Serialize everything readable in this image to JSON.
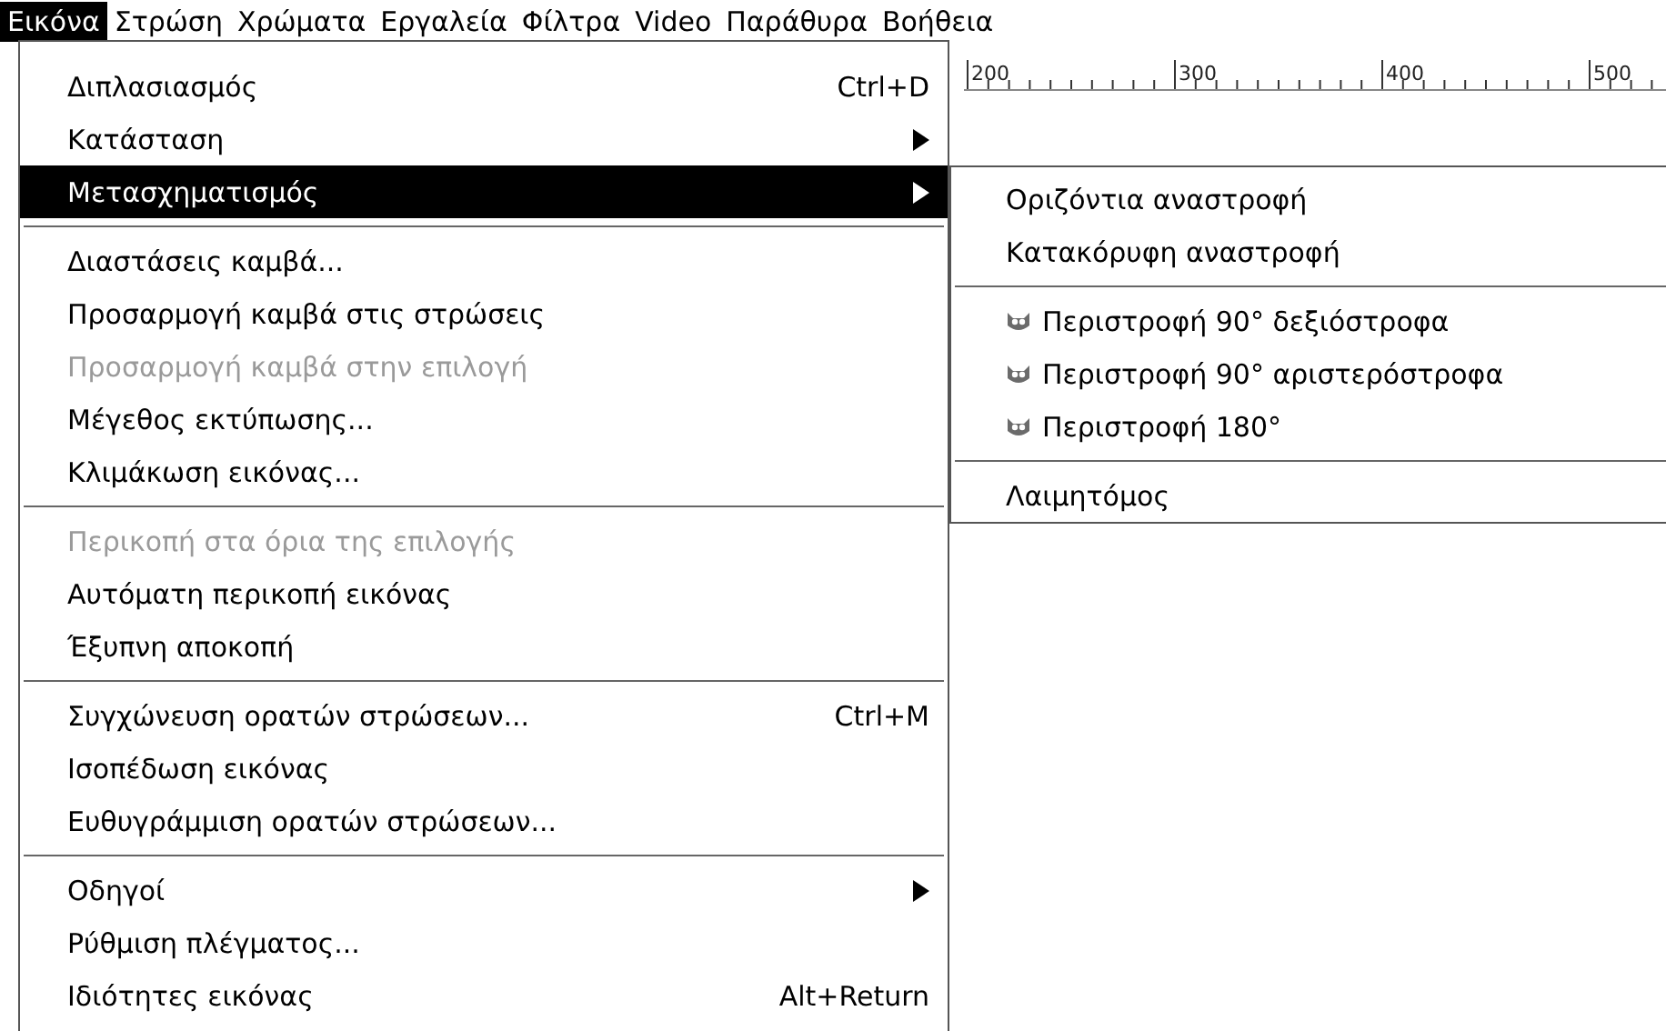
{
  "menubar": [
    {
      "label": "Εικόνα",
      "selected": true
    },
    {
      "label": "Στρώση",
      "selected": false
    },
    {
      "label": "Χρώματα",
      "selected": false
    },
    {
      "label": "Εργαλεία",
      "selected": false
    },
    {
      "label": "Φίλτρα",
      "selected": false
    },
    {
      "label": "Video",
      "selected": false
    },
    {
      "label": "Παράθυρα",
      "selected": false
    },
    {
      "label": "Βοήθεια",
      "selected": false
    }
  ],
  "ruler": {
    "labels": [
      "200",
      "300",
      "400",
      "500"
    ]
  },
  "menu": {
    "items": [
      {
        "kind": "item",
        "label": "Διπλασιασμός",
        "shortcut": "Ctrl+D",
        "submenu": false,
        "disabled": false,
        "selected": false
      },
      {
        "kind": "item",
        "label": "Κατάσταση",
        "submenu": true,
        "disabled": false,
        "selected": false
      },
      {
        "kind": "item",
        "label": "Μετασχηματισμός",
        "submenu": true,
        "disabled": false,
        "selected": true
      },
      {
        "kind": "separator"
      },
      {
        "kind": "item",
        "label": "Διαστάσεις καμβά...",
        "submenu": false,
        "disabled": false,
        "selected": false
      },
      {
        "kind": "item",
        "label": "Προσαρμογή καμβά στις στρώσεις",
        "submenu": false,
        "disabled": false,
        "selected": false
      },
      {
        "kind": "item",
        "label": "Προσαρμογή καμβά στην επιλογή",
        "submenu": false,
        "disabled": true,
        "selected": false
      },
      {
        "kind": "item",
        "label": "Μέγεθος εκτύπωσης...",
        "submenu": false,
        "disabled": false,
        "selected": false
      },
      {
        "kind": "item",
        "label": "Κλιμάκωση εικόνας...",
        "submenu": false,
        "disabled": false,
        "selected": false
      },
      {
        "kind": "separator"
      },
      {
        "kind": "item",
        "label": "Περικοπή στα όρια της επιλογής",
        "submenu": false,
        "disabled": true,
        "selected": false
      },
      {
        "kind": "item",
        "label": "Αυτόματη περικοπή εικόνας",
        "submenu": false,
        "disabled": false,
        "selected": false
      },
      {
        "kind": "item",
        "label": "Έξυπνη αποκοπή",
        "submenu": false,
        "disabled": false,
        "selected": false
      },
      {
        "kind": "separator"
      },
      {
        "kind": "item",
        "label": "Συγχώνευση ορατών στρώσεων...",
        "shortcut": "Ctrl+M",
        "submenu": false,
        "disabled": false,
        "selected": false
      },
      {
        "kind": "item",
        "label": "Ισοπέδωση εικόνας",
        "submenu": false,
        "disabled": false,
        "selected": false
      },
      {
        "kind": "item",
        "label": "Ευθυγράμμιση ορατών στρώσεων...",
        "submenu": false,
        "disabled": false,
        "selected": false
      },
      {
        "kind": "separator"
      },
      {
        "kind": "item",
        "label": "Οδηγοί",
        "submenu": true,
        "disabled": false,
        "selected": false
      },
      {
        "kind": "item",
        "label": "Ρύθμιση πλέγματος...",
        "submenu": false,
        "disabled": false,
        "selected": false
      },
      {
        "kind": "item",
        "label": "Ιδιότητες εικόνας",
        "shortcut": "Alt+Return",
        "submenu": false,
        "disabled": false,
        "selected": false
      }
    ]
  },
  "submenu": {
    "items": [
      {
        "kind": "item",
        "label": "Οριζόντια αναστροφή"
      },
      {
        "kind": "item",
        "label": "Κατακόρυφη αναστροφή"
      },
      {
        "kind": "separator"
      },
      {
        "kind": "icon-item",
        "label": "Περιστροφή 90° δεξιόστροφα"
      },
      {
        "kind": "icon-item",
        "label": "Περιστροφή 90° αριστερόστροφα"
      },
      {
        "kind": "icon-item",
        "label": "Περιστροφή 180°"
      },
      {
        "kind": "separator"
      },
      {
        "kind": "item",
        "label": "Λαιμητόμος"
      }
    ]
  }
}
